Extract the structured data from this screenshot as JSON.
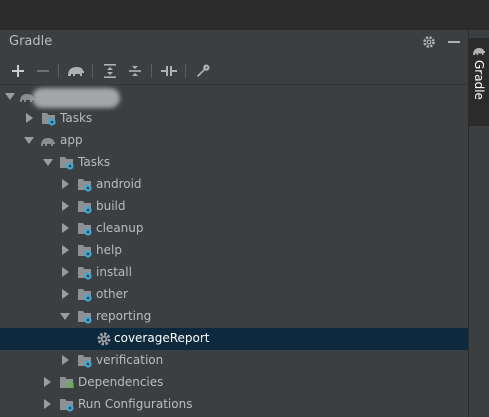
{
  "panel": {
    "title": "Gradle",
    "settings_icon": "gear-icon",
    "hide_icon": "minus-icon"
  },
  "toolbar": {
    "buttons": [
      {
        "icon": "plus-icon",
        "tooltip": ""
      },
      {
        "icon": "minus-icon",
        "tooltip": ""
      },
      {
        "icon": "elephant-icon",
        "tooltip": ""
      },
      {
        "icon": "expand-all-icon",
        "tooltip": ""
      },
      {
        "icon": "collapse-all-icon",
        "tooltip": ""
      },
      {
        "icon": "toggle-offline-icon",
        "tooltip": ""
      },
      {
        "icon": "wrench-icon",
        "tooltip": ""
      }
    ]
  },
  "tree": {
    "root_label_redacted": true,
    "items": [
      {
        "label": "Tasks"
      },
      {
        "label": "app"
      },
      {
        "label": "Tasks"
      },
      {
        "label": "android"
      },
      {
        "label": "build"
      },
      {
        "label": "cleanup"
      },
      {
        "label": "help"
      },
      {
        "label": "install"
      },
      {
        "label": "other"
      },
      {
        "label": "reporting"
      },
      {
        "label": "coverageReport"
      },
      {
        "label": "verification"
      },
      {
        "label": "Dependencies"
      },
      {
        "label": "Run Configurations"
      }
    ],
    "selected": "coverageReport"
  },
  "sidebar": {
    "tab_label": "Gradle"
  },
  "colors": {
    "background": "#3c3f41",
    "selection": "#0d293e",
    "text": "#bbbbbb",
    "gear_accent": "#40a6d8"
  }
}
